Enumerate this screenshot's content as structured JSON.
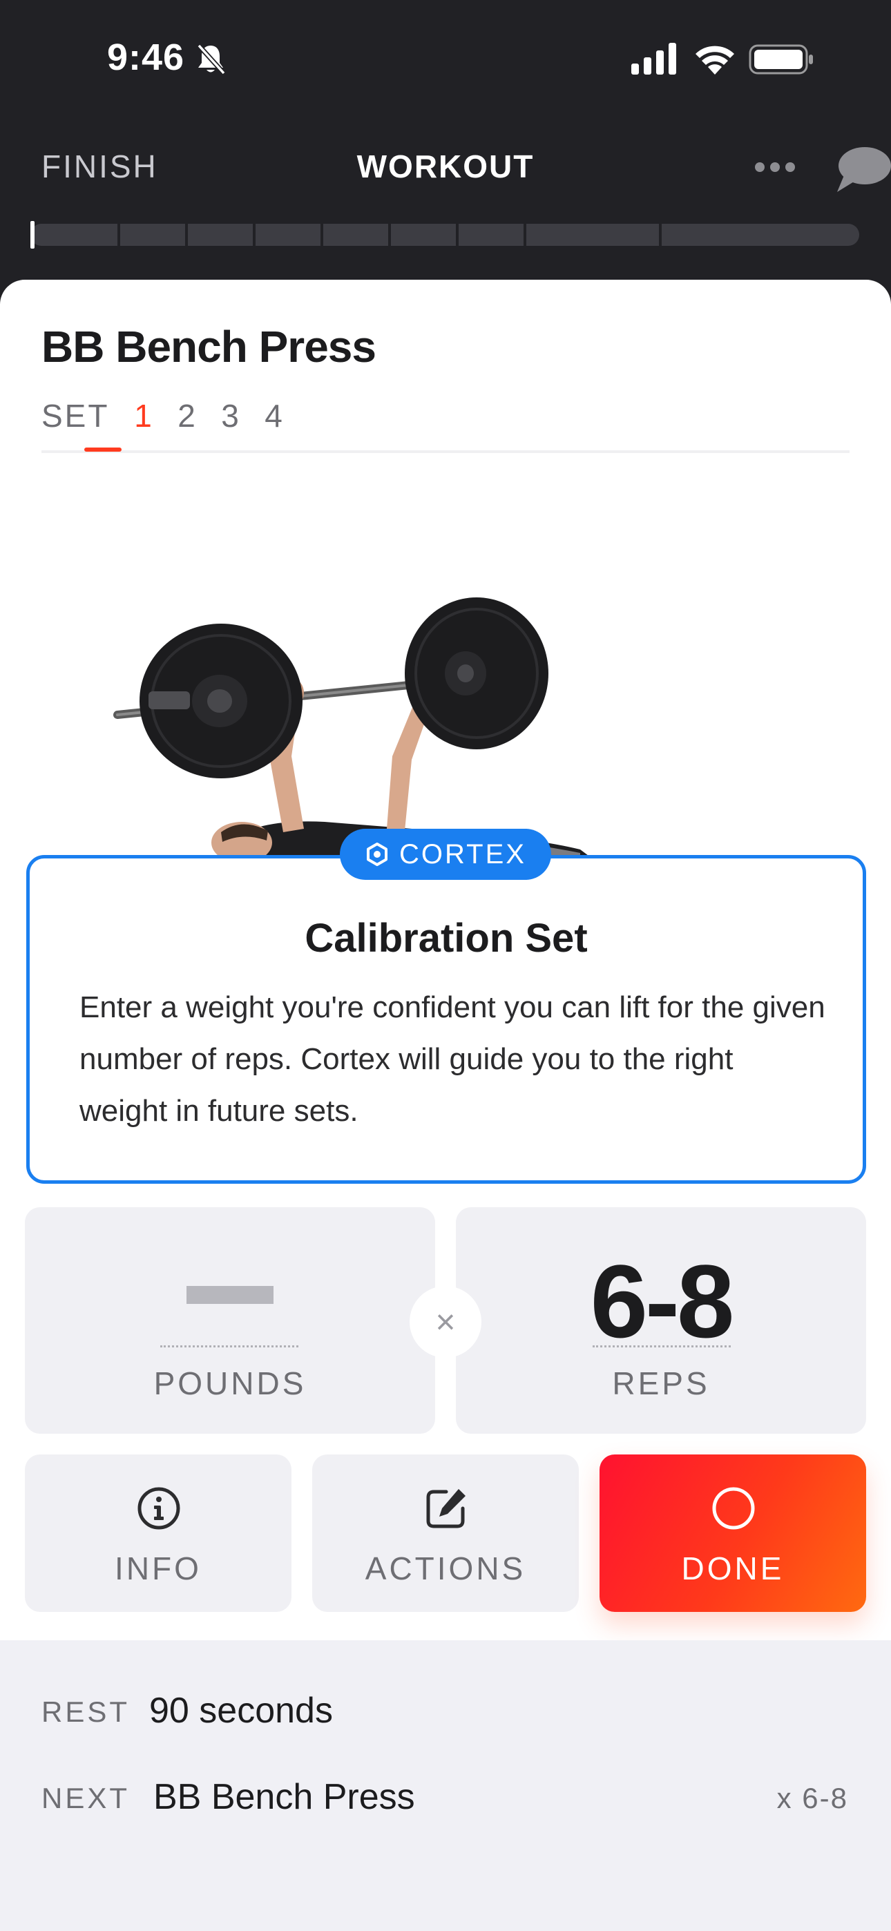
{
  "status_bar": {
    "time": "9:46",
    "icons": [
      "bell-slash-icon",
      "signal-icon",
      "wifi-icon",
      "battery-icon"
    ]
  },
  "nav": {
    "finish_label": "FINISH",
    "title": "WORKOUT",
    "more_icon": "more-icon",
    "chat_icon": "chat-icon"
  },
  "progress": {
    "segments": 10,
    "completed_segments": 0
  },
  "exercise": {
    "name": "BB Bench Press",
    "set_label": "SET",
    "sets": [
      "1",
      "2",
      "3",
      "4"
    ],
    "active_set": "1"
  },
  "cortex": {
    "badge": "CORTEX",
    "title": "Calibration Set",
    "text": "Enter a weight you're confident you can lift for the given number of reps. Cortex will guide you to the right weight in future sets."
  },
  "inputs": {
    "pounds_label": "POUNDS",
    "times_symbol": "×",
    "reps_value": "6-8",
    "reps_label": "REPS"
  },
  "buttons": {
    "info": "INFO",
    "actions": "ACTIONS",
    "done": "DONE"
  },
  "footer": {
    "rest_key": "REST",
    "rest_value": "90 seconds",
    "next_key": "NEXT",
    "next_value": "BB Bench Press",
    "next_reps": "x 6-8"
  },
  "colors": {
    "accent_red": "#ff3b1f",
    "cortex_blue": "#1a7ff0",
    "dark_header": "#212125"
  }
}
